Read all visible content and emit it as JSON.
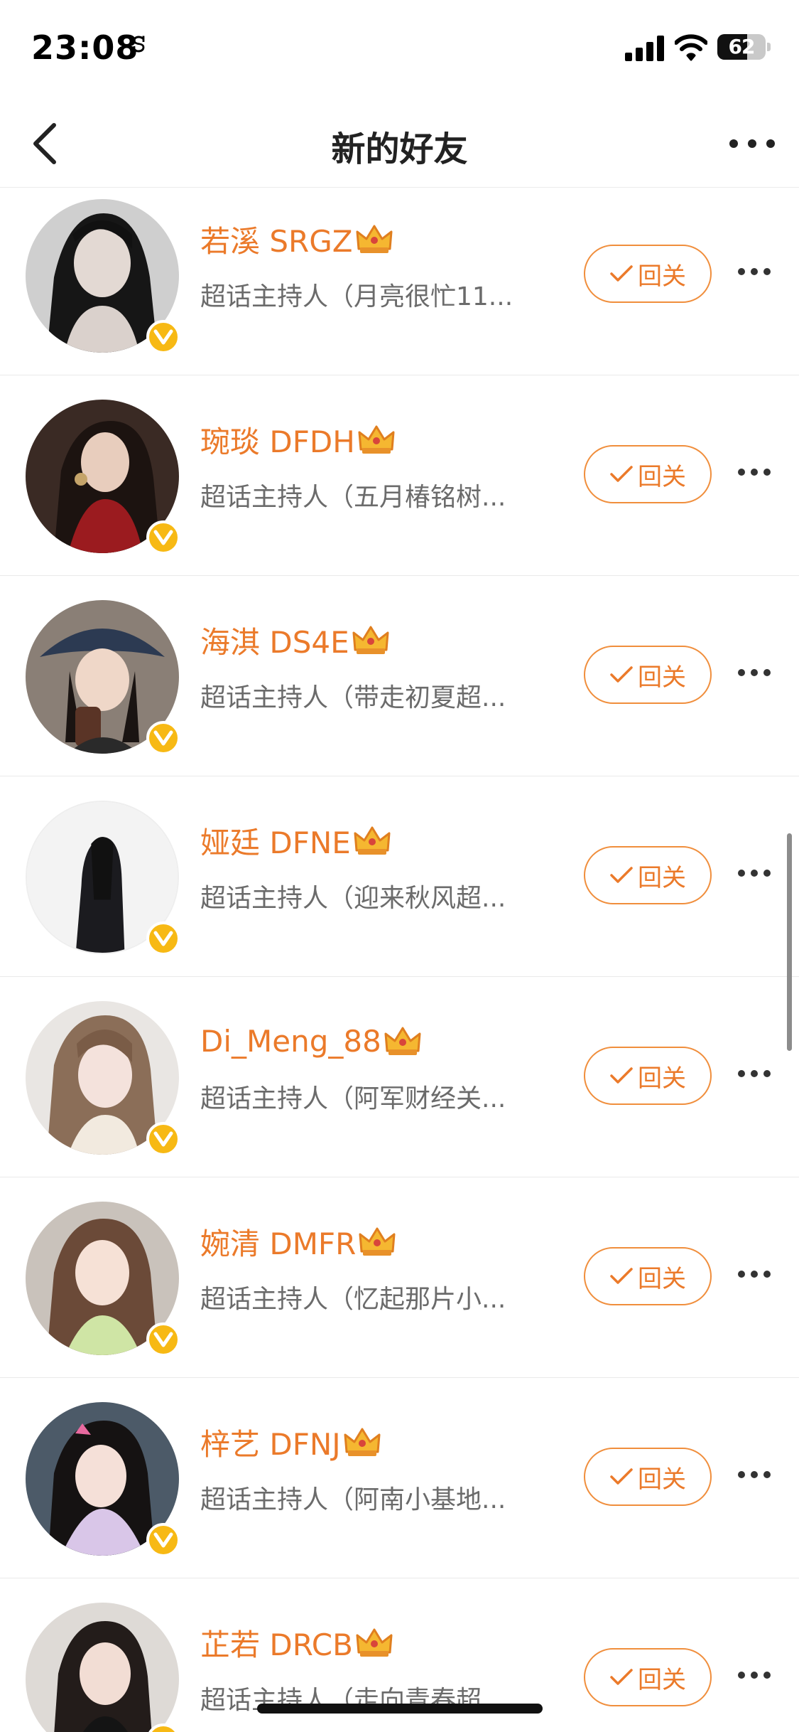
{
  "status_bar": {
    "time": "23:08",
    "glyph": "ꕶ",
    "battery": "62"
  },
  "nav": {
    "title": "新的好友"
  },
  "users": [
    {
      "name": "若溪 SRGZ",
      "desc": "超话主持人（月亮很忙11...",
      "follow": "回关"
    },
    {
      "name": "琬琰 DFDH",
      "desc": "超话主持人（五月椿铭树...",
      "follow": "回关"
    },
    {
      "name": "海淇 DS4E",
      "desc": "超话主持人（带走初夏超...",
      "follow": "回关"
    },
    {
      "name": "娅廷 DFNE",
      "desc": "超话主持人（迎来秋风超...",
      "follow": "回关"
    },
    {
      "name": "Di_Meng_88",
      "desc": "超话主持人（阿军财经关...",
      "follow": "回关"
    },
    {
      "name": "婉清 DMFR",
      "desc": "超话主持人（忆起那片小...",
      "follow": "回关"
    },
    {
      "name": "梓艺 DFNJ",
      "desc": "超话主持人（阿南小基地...",
      "follow": "回关"
    },
    {
      "name": "芷若 DRCB",
      "desc": "超话主持人（走向青春超...",
      "follow": "回关"
    }
  ],
  "colors": {
    "accent": "#eb7a2a",
    "verified": "#f7b914"
  },
  "icons": {
    "back": "chevron-left-icon",
    "more": "more-dots-icon",
    "badge": "verified-v-icon",
    "crown": "crown-icon",
    "check": "check-icon"
  }
}
